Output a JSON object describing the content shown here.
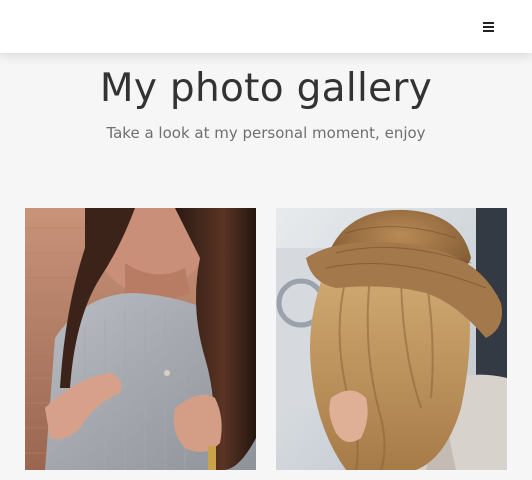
{
  "navbar": {
    "menu_icon": "hamburger-menu-icon"
  },
  "hero": {
    "title": "My photo gallery",
    "subtitle": "Take a look at my personal moment, enjoy"
  },
  "gallery": {
    "photos": [
      {
        "subject": "woman-gray-sweater-dark-hair"
      },
      {
        "subject": "woman-straw-hat-blonde-hair"
      }
    ]
  },
  "colors": {
    "background": "#f6f6f6",
    "navbar": "#ffffff",
    "title": "#333333",
    "subtitle": "#6f6f6f"
  }
}
